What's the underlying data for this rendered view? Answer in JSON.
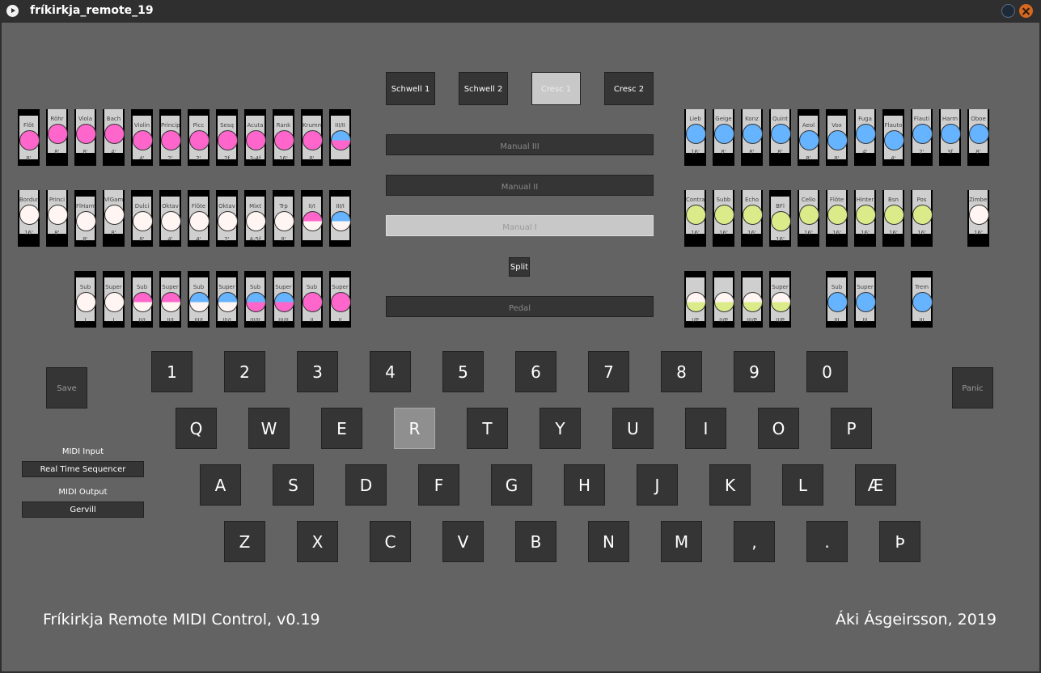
{
  "window": {
    "title": "fríkirkja_remote_19"
  },
  "colors": {
    "pink": "#ff66cc",
    "blue": "#66b3ff",
    "green": "#dbeb8a",
    "white": "#fff5f2"
  },
  "expression": [
    {
      "label": "Schwell 1",
      "selected": false
    },
    {
      "label": "Schwell 2",
      "selected": false
    },
    {
      "label": "Cresc 1",
      "selected": true
    },
    {
      "label": "Cresc 2",
      "selected": false
    }
  ],
  "manuals": [
    {
      "label": "Manual III",
      "selected": false
    },
    {
      "label": "Manual II",
      "selected": false
    },
    {
      "label": "Manual I",
      "selected": true
    },
    {
      "label": "Pedal",
      "selected": false
    }
  ],
  "split_label": "Split",
  "stops": {
    "left_row1": [
      {
        "name": "Flöt",
        "size": "8'",
        "style": "pink",
        "down": false
      },
      {
        "name": "Röhr",
        "size": "8'",
        "style": "pink",
        "down": true
      },
      {
        "name": "Viola",
        "size": "8'",
        "style": "pink",
        "down": true
      },
      {
        "name": "Bach",
        "size": "4'",
        "style": "pink",
        "down": true
      },
      {
        "name": "Violin",
        "size": "4'",
        "style": "pink",
        "down": false
      },
      {
        "name": "Princip",
        "size": "2'",
        "style": "pink",
        "down": false
      },
      {
        "name": "Picc",
        "size": "2'",
        "style": "pink",
        "down": false
      },
      {
        "name": "Sesq",
        "size": "2f",
        "style": "pink",
        "down": false
      },
      {
        "name": "Acuta",
        "size": "3-4f",
        "style": "pink",
        "down": false
      },
      {
        "name": "Rank",
        "size": "16'",
        "style": "pink",
        "down": false
      },
      {
        "name": "Krumm",
        "size": "8'",
        "style": "pink",
        "down": false
      },
      {
        "name": "III/II",
        "size": "",
        "style": "blue-pink",
        "down": false
      }
    ],
    "left_row2": [
      {
        "name": "Bordun",
        "size": "16'",
        "style": "white",
        "down": true
      },
      {
        "name": "Princi",
        "size": "8'",
        "style": "white",
        "down": true
      },
      {
        "name": "FlHarm",
        "size": "8'",
        "style": "white",
        "down": false
      },
      {
        "name": "VlGamb",
        "size": "8'",
        "style": "white",
        "down": true
      },
      {
        "name": "Dulci",
        "size": "8'",
        "style": "white",
        "down": false
      },
      {
        "name": "Oktav",
        "size": "4'",
        "style": "white",
        "down": false
      },
      {
        "name": "Flöte",
        "size": "4'",
        "style": "white",
        "down": false
      },
      {
        "name": "Oktav",
        "size": "2'",
        "style": "white",
        "down": false
      },
      {
        "name": "Mixt",
        "size": "4-5f",
        "style": "white",
        "down": false
      },
      {
        "name": "Trp",
        "size": "8'",
        "style": "white",
        "down": false
      },
      {
        "name": "II/I",
        "size": "",
        "style": "pink-white",
        "down": false
      },
      {
        "name": "III/I",
        "size": "",
        "style": "blue-white",
        "down": false
      }
    ],
    "left_row3": [
      {
        "name": "Sub",
        "size": "I",
        "style": "white",
        "down": false
      },
      {
        "name": "Super",
        "size": "I",
        "style": "white",
        "down": false
      },
      {
        "name": "Sub",
        "size": "II/I",
        "style": "pink-white",
        "down": false
      },
      {
        "name": "Super",
        "size": "II/I",
        "style": "pink-white",
        "down": false
      },
      {
        "name": "Sub",
        "size": "III/I",
        "style": "blue-white",
        "down": false
      },
      {
        "name": "Super",
        "size": "III/I",
        "style": "blue-white",
        "down": false
      },
      {
        "name": "Sub",
        "size": "III/II",
        "style": "blue-pink",
        "down": false
      },
      {
        "name": "Super",
        "size": "III/II",
        "style": "blue-pink",
        "down": false
      },
      {
        "name": "Sub",
        "size": "II",
        "style": "pink",
        "down": false
      },
      {
        "name": "Super",
        "size": "II",
        "style": "pink",
        "down": false
      }
    ],
    "right_row1": [
      {
        "name": "Lieb",
        "size": "16'",
        "style": "blue",
        "down": true
      },
      {
        "name": "Geige",
        "size": "8'",
        "style": "blue",
        "down": true
      },
      {
        "name": "Konz",
        "size": "8'",
        "style": "blue",
        "down": true
      },
      {
        "name": "Quint",
        "size": "8'",
        "style": "blue",
        "down": true
      },
      {
        "name": "Aeol",
        "size": "8'",
        "style": "blue",
        "down": false
      },
      {
        "name": "Vox",
        "size": "8'",
        "style": "blue",
        "down": false
      },
      {
        "name": "Fuga",
        "size": "4'",
        "style": "blue",
        "down": true
      },
      {
        "name": "Flauto",
        "size": "4'",
        "style": "blue",
        "down": false
      },
      {
        "name": "Flauti",
        "size": "2'",
        "style": "blue",
        "down": true
      },
      {
        "name": "Harm",
        "size": "3f",
        "style": "blue",
        "down": true
      },
      {
        "name": "Oboe",
        "size": "8'",
        "style": "blue",
        "down": true
      }
    ],
    "right_row2": [
      {
        "name": "Contra",
        "size": "16'",
        "style": "green",
        "down": true
      },
      {
        "name": "Subb",
        "size": "16'",
        "style": "green",
        "down": true
      },
      {
        "name": "Echo",
        "size": "16'",
        "style": "green",
        "down": true
      },
      {
        "name": "BFl",
        "size": "16'",
        "style": "green",
        "down": false
      },
      {
        "name": "Cello",
        "size": "16'",
        "style": "green",
        "down": true
      },
      {
        "name": "Flöte",
        "size": "16'",
        "style": "green",
        "down": true
      },
      {
        "name": "Hinter",
        "size": "16'",
        "style": "green",
        "down": true
      },
      {
        "name": "Bsn",
        "size": "16'",
        "style": "green",
        "down": true
      },
      {
        "name": "Pos",
        "size": "16'",
        "style": "green",
        "down": true
      },
      {
        "name": "Zimbel",
        "size": "16'",
        "style": "white",
        "down": true
      }
    ],
    "right_row3": [
      {
        "name": "",
        "size": "I/P",
        "style": "white-green",
        "down": false
      },
      {
        "name": "",
        "size": "II/P",
        "style": "white-green",
        "down": false
      },
      {
        "name": "",
        "size": "III/P",
        "style": "white-green",
        "down": false
      },
      {
        "name": "Super",
        "size": "II/P",
        "style": "white-green",
        "down": false
      },
      {
        "name": "Sub",
        "size": "III",
        "style": "blue",
        "down": false
      },
      {
        "name": "Super",
        "size": "III",
        "style": "blue",
        "down": false
      },
      {
        "name": "Trem",
        "size": "III",
        "style": "blue",
        "down": false
      }
    ]
  },
  "keyboard": {
    "row1": [
      "1",
      "2",
      "3",
      "4",
      "5",
      "6",
      "7",
      "8",
      "9",
      "0"
    ],
    "row2": [
      "Q",
      "W",
      "E",
      "R",
      "T",
      "Y",
      "U",
      "I",
      "O",
      "P"
    ],
    "row3": [
      "A",
      "S",
      "D",
      "F",
      "G",
      "H",
      "J",
      "K",
      "L",
      "Æ"
    ],
    "row4": [
      "Z",
      "X",
      "C",
      "V",
      "B",
      "N",
      "M",
      ",",
      ".",
      "Þ"
    ],
    "pressed": "R"
  },
  "save_label": "Save",
  "panic_label": "Panic",
  "midi": {
    "input_label": "MIDI Input",
    "input_value": "Real Time Sequencer",
    "output_label": "MIDI Output",
    "output_value": "Gervill"
  },
  "footer": {
    "left": "Fríkirkja Remote MIDI Control, v0.19",
    "right": "Áki Ásgeirsson, 2019"
  }
}
